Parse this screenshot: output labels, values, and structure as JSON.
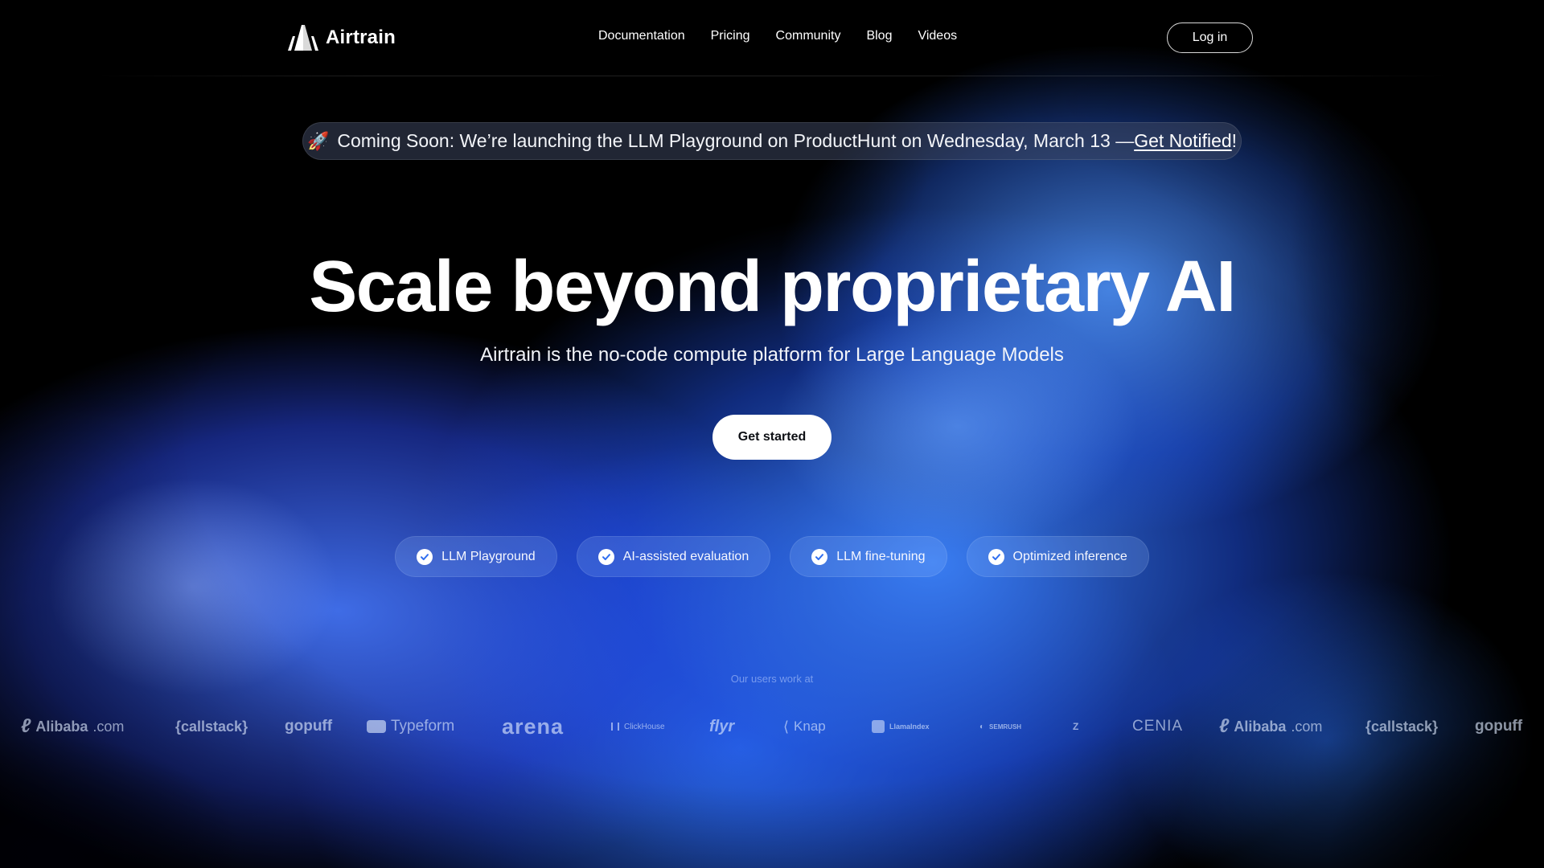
{
  "header": {
    "brand": "Airtrain",
    "nav": [
      "Documentation",
      "Pricing",
      "Community",
      "Blog",
      "Videos"
    ],
    "login_label": "Log in"
  },
  "announcement": {
    "text": "Coming Soon: We’re launching the LLM Playground on ProductHunt on Wednesday, March 13 — ",
    "link_label": "Get Notified",
    "suffix": "!"
  },
  "hero": {
    "title": "Scale beyond proprietary AI",
    "subtitle": "Airtrain is the no-code compute platform for Large Language Models",
    "cta_label": "Get started"
  },
  "features": [
    "LLM Playground",
    "AI-assisted evaluation",
    "LLM fine-tuning",
    "Optimized inference"
  ],
  "users": {
    "label": "Our users work at",
    "logos": [
      {
        "name": "alibaba-logo",
        "text": "Alibaba",
        "suffix": ".com"
      },
      {
        "name": "callstack-logo",
        "text": "{callstack}"
      },
      {
        "name": "gopuff-logo",
        "text": "gopuff"
      },
      {
        "name": "typeform-logo",
        "text": "Typeform"
      },
      {
        "name": "arena-logo",
        "text": "arena"
      },
      {
        "name": "clickhouse-logo",
        "text": "ClickHouse"
      },
      {
        "name": "flyr-logo",
        "text": "flyr"
      },
      {
        "name": "knap-logo",
        "text": "Knap"
      },
      {
        "name": "llamaindex-logo",
        "text": "LlamaIndex"
      },
      {
        "name": "semrush-logo",
        "text": "SEMRUSH"
      },
      {
        "name": "z-logo",
        "text": "Z"
      },
      {
        "name": "cenia-logo",
        "text": "CENIA"
      },
      {
        "name": "alibaba-logo",
        "text": "Alibaba",
        "suffix": ".com"
      },
      {
        "name": "callstack-logo",
        "text": "{callstack}"
      },
      {
        "name": "gopuff-logo",
        "text": "gopuff"
      }
    ]
  },
  "colors": {
    "accent_blue": "#3f7ef7",
    "background": "#000000",
    "cta_bg": "#ffffff"
  }
}
